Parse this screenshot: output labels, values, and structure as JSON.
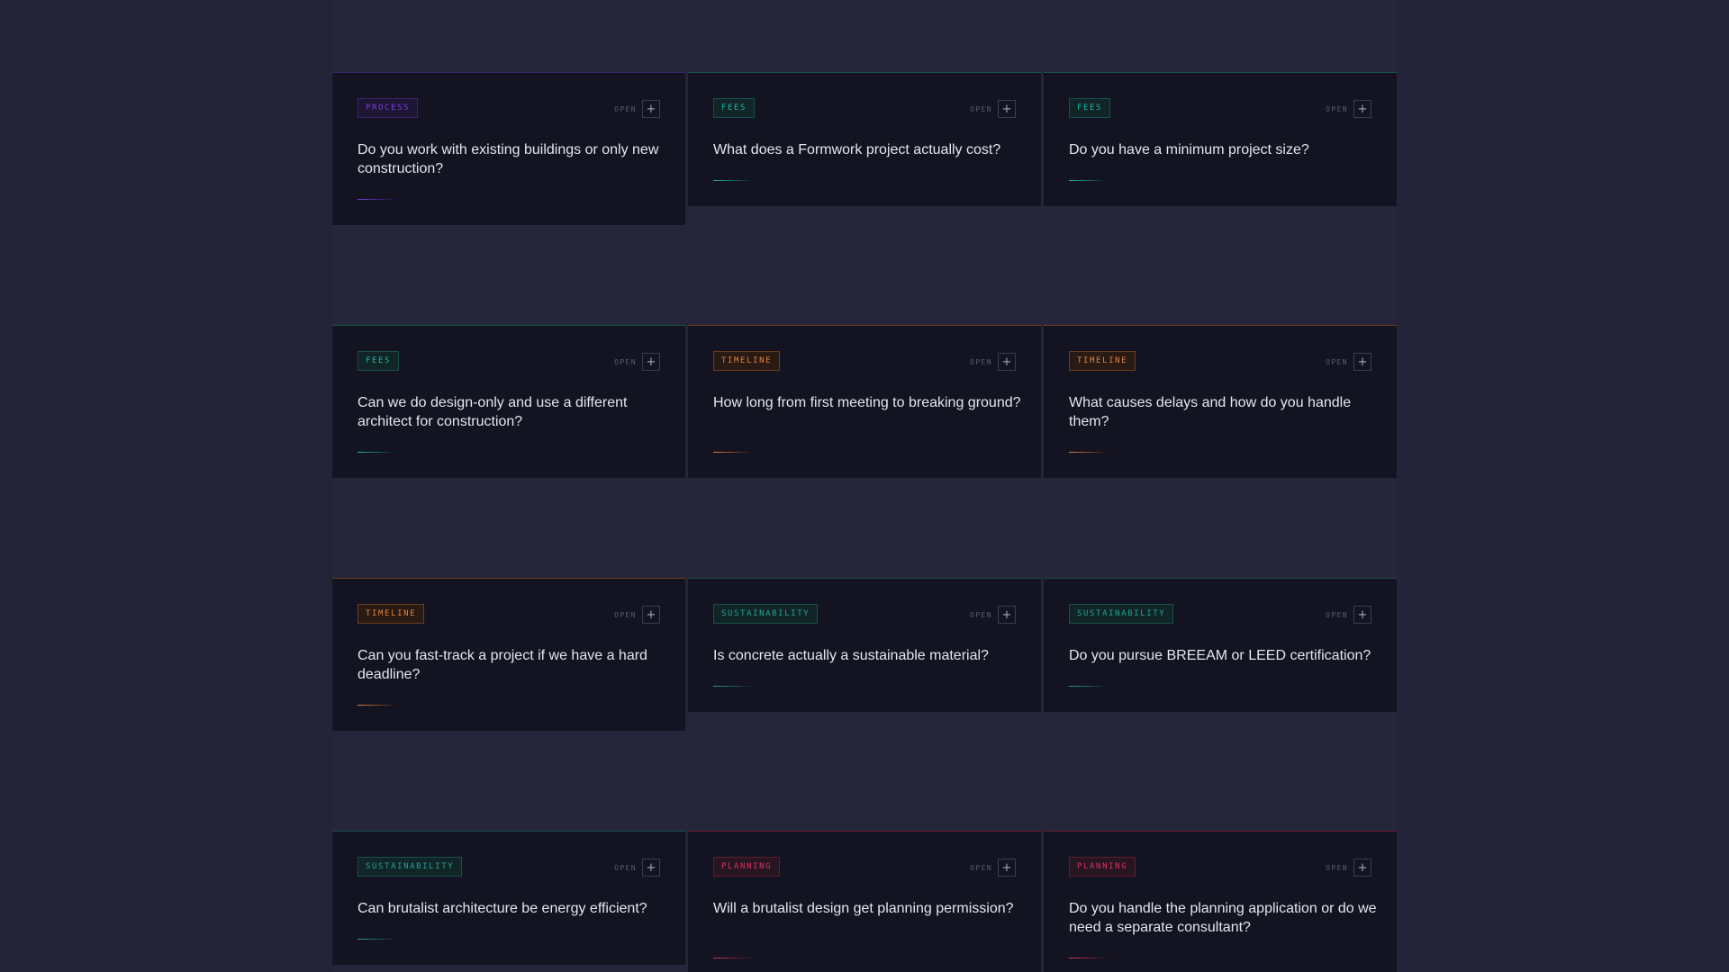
{
  "open_label": "OPEN",
  "plus_glyph": "+",
  "colors": {
    "process": "#7b3fe0",
    "fees": "#1fb5a3",
    "timeline": "#e0823a",
    "sustainability": "#20a394",
    "planning": "#d6345f"
  },
  "faq": [
    {
      "category": "PROCESS",
      "question": "Do you work with existing buildings or only new construction?"
    },
    {
      "category": "FEES",
      "question": "What does a Formwork project actually cost?"
    },
    {
      "category": "FEES",
      "question": "Do you have a minimum project size?"
    },
    {
      "category": "FEES",
      "question": "Can we do design-only and use a different architect for construction?"
    },
    {
      "category": "TIMELINE",
      "question": "How long from first meeting to breaking ground?"
    },
    {
      "category": "TIMELINE",
      "question": "What causes delays and how do you handle them?"
    },
    {
      "category": "TIMELINE",
      "question": "Can you fast-track a project if we have a hard deadline?"
    },
    {
      "category": "SUSTAINABILITY",
      "question": "Is concrete actually a sustainable material?"
    },
    {
      "category": "SUSTAINABILITY",
      "question": "Do you pursue BREEAM or LEED certification?"
    },
    {
      "category": "SUSTAINABILITY",
      "question": "Can brutalist architecture be energy efficient?"
    },
    {
      "category": "PLANNING",
      "question": "Will a brutalist design get planning permission?"
    },
    {
      "category": "PLANNING",
      "question": "Do you handle the planning application or do we need a separate consultant?"
    }
  ]
}
